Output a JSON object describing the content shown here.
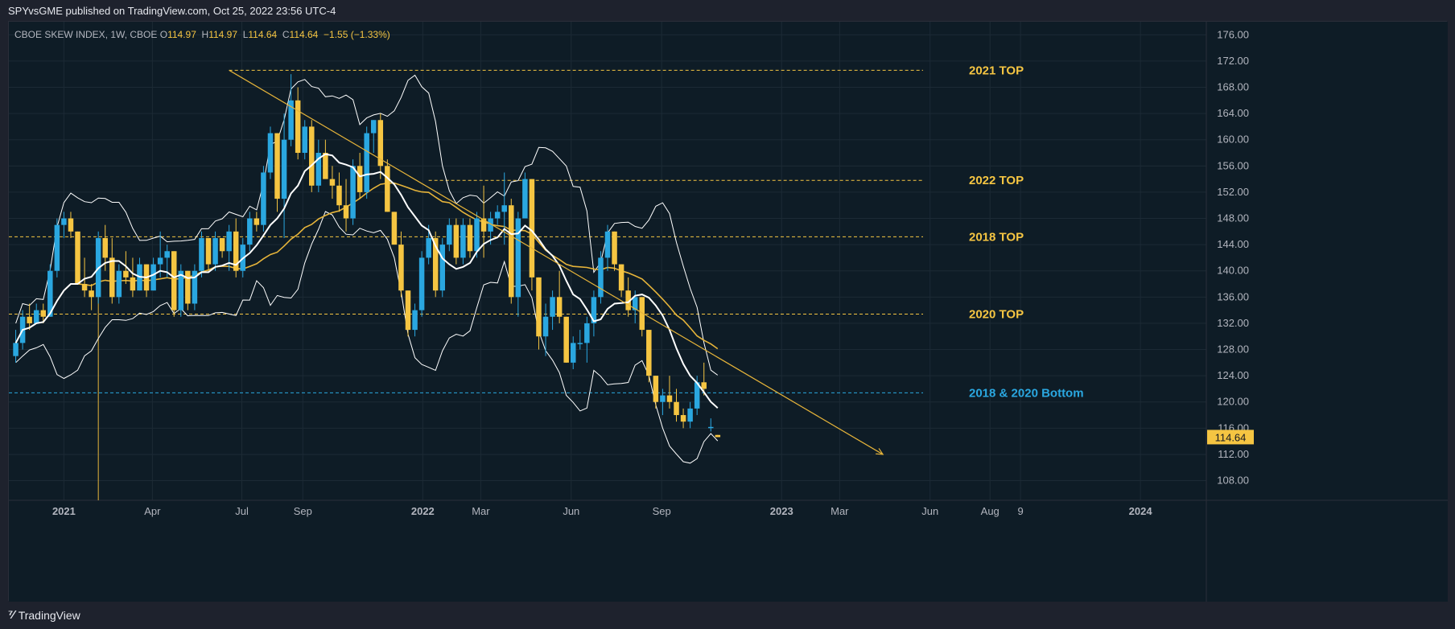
{
  "header": {
    "publish_line": "SPYvsGME published on TradingView.com, Oct 25, 2022 23:56 UTC-4"
  },
  "legend": {
    "symbol": "CBOE SKEW INDEX, 1W, CBOE",
    "o_label": "O",
    "o_value": "114.97",
    "h_label": "H",
    "h_value": "114.97",
    "l_label": "L",
    "l_value": "114.64",
    "c_label": "C",
    "c_value": "114.64",
    "change": "−1.55 (−1.33%)"
  },
  "footer": {
    "brand": "TradingView",
    "logo_icon": "tradingview-logo-icon"
  },
  "colors": {
    "background": "#0e1c26",
    "up": "#2aa7e0",
    "down": "#f5c542",
    "band": "#ffffff",
    "ma": "#e6b43a",
    "level_yellow": "#f5c542",
    "level_blue": "#2aa7e0",
    "axis_text": "#b2b5be",
    "grid": "#1c2a35"
  },
  "chart_data": {
    "type": "candlestick",
    "title": "CBOE SKEW INDEX, 1W, CBOE",
    "x_axis": {
      "tick_labels": [
        "2021",
        "Apr",
        "Jul",
        "Sep",
        "2022",
        "Mar",
        "Jun",
        "Sep",
        "2023",
        "Mar",
        "Jun",
        "Aug",
        "9",
        "2024"
      ],
      "tick_dates": [
        "2021-01-01",
        "2021-04-01",
        "2021-07-01",
        "2021-09-01",
        "2022-01-01",
        "2022-03-01",
        "2022-06-01",
        "2022-09-01",
        "2023-01-01",
        "2023-03-01",
        "2023-06-01",
        "2023-08-01",
        "2023-09-01",
        "2024-01-01"
      ],
      "range": [
        "2020-11-06",
        "2024-03-08"
      ]
    },
    "y_axis": {
      "tick_labels": [
        "108.00",
        "112.00",
        "116.00",
        "120.00",
        "124.00",
        "128.00",
        "132.00",
        "136.00",
        "140.00",
        "144.00",
        "148.00",
        "152.00",
        "156.00",
        "160.00",
        "164.00",
        "168.00",
        "172.00",
        "176.00"
      ],
      "range": [
        105,
        178
      ],
      "last_price_label": "114.64"
    },
    "grid": true,
    "candles": [
      {
        "date": "2020-11-13",
        "o": 127,
        "h": 131,
        "l": 126,
        "c": 129
      },
      {
        "date": "2020-11-20",
        "o": 129,
        "h": 134,
        "l": 128,
        "c": 133
      },
      {
        "date": "2020-11-27",
        "o": 133,
        "h": 135,
        "l": 131,
        "c": 132
      },
      {
        "date": "2020-12-04",
        "o": 132,
        "h": 135,
        "l": 132,
        "c": 134
      },
      {
        "date": "2020-12-11",
        "o": 134,
        "h": 135,
        "l": 132,
        "c": 133
      },
      {
        "date": "2020-12-18",
        "o": 133,
        "h": 141,
        "l": 133,
        "c": 140
      },
      {
        "date": "2020-12-25",
        "o": 140,
        "h": 148,
        "l": 139,
        "c": 147
      },
      {
        "date": "2021-01-01",
        "o": 147,
        "h": 149,
        "l": 145,
        "c": 148
      },
      {
        "date": "2021-01-08",
        "o": 148,
        "h": 149,
        "l": 145,
        "c": 146
      },
      {
        "date": "2021-01-15",
        "o": 146,
        "h": 146,
        "l": 138,
        "c": 138
      },
      {
        "date": "2021-01-22",
        "o": 138,
        "h": 142,
        "l": 136,
        "c": 137
      },
      {
        "date": "2021-01-29",
        "o": 137,
        "h": 138,
        "l": 134,
        "c": 136
      },
      {
        "date": "2021-02-05",
        "o": 136,
        "h": 146,
        "l": 135,
        "c": 145
      },
      {
        "date": "2021-02-12",
        "o": 145,
        "h": 147,
        "l": 140,
        "c": 142
      },
      {
        "date": "2021-02-19",
        "o": 142,
        "h": 145,
        "l": 135,
        "c": 136
      },
      {
        "date": "2021-02-26",
        "o": 136,
        "h": 141,
        "l": 135,
        "c": 140
      },
      {
        "date": "2021-03-05",
        "o": 140,
        "h": 143,
        "l": 138,
        "c": 139
      },
      {
        "date": "2021-03-12",
        "o": 139,
        "h": 142,
        "l": 136,
        "c": 137
      },
      {
        "date": "2021-03-19",
        "o": 137,
        "h": 142,
        "l": 137,
        "c": 141
      },
      {
        "date": "2021-03-26",
        "o": 141,
        "h": 141,
        "l": 136,
        "c": 137
      },
      {
        "date": "2021-04-02",
        "o": 137,
        "h": 142,
        "l": 137,
        "c": 141
      },
      {
        "date": "2021-04-09",
        "o": 141,
        "h": 146,
        "l": 139,
        "c": 142
      },
      {
        "date": "2021-04-16",
        "o": 142,
        "h": 144,
        "l": 139,
        "c": 143
      },
      {
        "date": "2021-04-23",
        "o": 143,
        "h": 143,
        "l": 133,
        "c": 134
      },
      {
        "date": "2021-04-30",
        "o": 134,
        "h": 141,
        "l": 133,
        "c": 140
      },
      {
        "date": "2021-05-07",
        "o": 140,
        "h": 140,
        "l": 134,
        "c": 135
      },
      {
        "date": "2021-05-14",
        "o": 135,
        "h": 141,
        "l": 134,
        "c": 140
      },
      {
        "date": "2021-05-21",
        "o": 140,
        "h": 146,
        "l": 139,
        "c": 145
      },
      {
        "date": "2021-05-28",
        "o": 145,
        "h": 145,
        "l": 140,
        "c": 141
      },
      {
        "date": "2021-06-04",
        "o": 141,
        "h": 146,
        "l": 140,
        "c": 145
      },
      {
        "date": "2021-06-11",
        "o": 145,
        "h": 145,
        "l": 142,
        "c": 143
      },
      {
        "date": "2021-06-18",
        "o": 143,
        "h": 147,
        "l": 140,
        "c": 146
      },
      {
        "date": "2021-06-25",
        "o": 146,
        "h": 148,
        "l": 139,
        "c": 140
      },
      {
        "date": "2021-07-02",
        "o": 140,
        "h": 145,
        "l": 139,
        "c": 144
      },
      {
        "date": "2021-07-09",
        "o": 144,
        "h": 149,
        "l": 143,
        "c": 148
      },
      {
        "date": "2021-07-16",
        "o": 148,
        "h": 149,
        "l": 146,
        "c": 147
      },
      {
        "date": "2021-07-23",
        "o": 147,
        "h": 156,
        "l": 146,
        "c": 155
      },
      {
        "date": "2021-07-30",
        "o": 155,
        "h": 162,
        "l": 154,
        "c": 161
      },
      {
        "date": "2021-08-06",
        "o": 161,
        "h": 161,
        "l": 149,
        "c": 151
      },
      {
        "date": "2021-08-13",
        "o": 151,
        "h": 164,
        "l": 145,
        "c": 160
      },
      {
        "date": "2021-08-20",
        "o": 160,
        "h": 170,
        "l": 159,
        "c": 166
      },
      {
        "date": "2021-08-27",
        "o": 166,
        "h": 168,
        "l": 157,
        "c": 158
      },
      {
        "date": "2021-09-03",
        "o": 158,
        "h": 163,
        "l": 157,
        "c": 162
      },
      {
        "date": "2021-09-10",
        "o": 162,
        "h": 163,
        "l": 152,
        "c": 153
      },
      {
        "date": "2021-09-17",
        "o": 153,
        "h": 160,
        "l": 152,
        "c": 158
      },
      {
        "date": "2021-09-24",
        "o": 158,
        "h": 160,
        "l": 155,
        "c": 154
      },
      {
        "date": "2021-10-01",
        "o": 154,
        "h": 156,
        "l": 151,
        "c": 153
      },
      {
        "date": "2021-10-08",
        "o": 153,
        "h": 155,
        "l": 149,
        "c": 150
      },
      {
        "date": "2021-10-15",
        "o": 150,
        "h": 154,
        "l": 146,
        "c": 148
      },
      {
        "date": "2021-10-22",
        "o": 148,
        "h": 157,
        "l": 147,
        "c": 156
      },
      {
        "date": "2021-10-29",
        "o": 156,
        "h": 158,
        "l": 151,
        "c": 152
      },
      {
        "date": "2021-11-05",
        "o": 152,
        "h": 162,
        "l": 151,
        "c": 161
      },
      {
        "date": "2021-11-12",
        "o": 161,
        "h": 163,
        "l": 158,
        "c": 163
      },
      {
        "date": "2021-11-19",
        "o": 163,
        "h": 164,
        "l": 154,
        "c": 156
      },
      {
        "date": "2021-11-26",
        "o": 156,
        "h": 157,
        "l": 149,
        "c": 149
      },
      {
        "date": "2021-12-03",
        "o": 149,
        "h": 149,
        "l": 144,
        "c": 144
      },
      {
        "date": "2021-12-10",
        "o": 144,
        "h": 146,
        "l": 136,
        "c": 137
      },
      {
        "date": "2021-12-17",
        "o": 137,
        "h": 137,
        "l": 130,
        "c": 131
      },
      {
        "date": "2021-12-24",
        "o": 131,
        "h": 135,
        "l": 130,
        "c": 134
      },
      {
        "date": "2021-12-31",
        "o": 134,
        "h": 143,
        "l": 133,
        "c": 142
      },
      {
        "date": "2022-01-07",
        "o": 142,
        "h": 147,
        "l": 141,
        "c": 145
      },
      {
        "date": "2022-01-14",
        "o": 145,
        "h": 146,
        "l": 136,
        "c": 137
      },
      {
        "date": "2022-01-21",
        "o": 137,
        "h": 145,
        "l": 136,
        "c": 144
      },
      {
        "date": "2022-01-28",
        "o": 144,
        "h": 148,
        "l": 143,
        "c": 147
      },
      {
        "date": "2022-02-04",
        "o": 147,
        "h": 148,
        "l": 141,
        "c": 142
      },
      {
        "date": "2022-02-11",
        "o": 142,
        "h": 148,
        "l": 141,
        "c": 147
      },
      {
        "date": "2022-02-18",
        "o": 147,
        "h": 148,
        "l": 142,
        "c": 143
      },
      {
        "date": "2022-02-25",
        "o": 143,
        "h": 149,
        "l": 142,
        "c": 148
      },
      {
        "date": "2022-03-04",
        "o": 148,
        "h": 153,
        "l": 142,
        "c": 146
      },
      {
        "date": "2022-03-11",
        "o": 146,
        "h": 149,
        "l": 144,
        "c": 148
      },
      {
        "date": "2022-03-18",
        "o": 148,
        "h": 150,
        "l": 147,
        "c": 149
      },
      {
        "date": "2022-03-25",
        "o": 149,
        "h": 155,
        "l": 144,
        "c": 150
      },
      {
        "date": "2022-04-01",
        "o": 150,
        "h": 151,
        "l": 135,
        "c": 136
      },
      {
        "date": "2022-04-08",
        "o": 136,
        "h": 149,
        "l": 133,
        "c": 148
      },
      {
        "date": "2022-04-15",
        "o": 148,
        "h": 155,
        "l": 148,
        "c": 154
      },
      {
        "date": "2022-04-22",
        "o": 154,
        "h": 154,
        "l": 137,
        "c": 139
      },
      {
        "date": "2022-04-29",
        "o": 139,
        "h": 139,
        "l": 128,
        "c": 130
      },
      {
        "date": "2022-05-06",
        "o": 130,
        "h": 135,
        "l": 127,
        "c": 133
      },
      {
        "date": "2022-05-13",
        "o": 133,
        "h": 137,
        "l": 131,
        "c": 136
      },
      {
        "date": "2022-05-20",
        "o": 136,
        "h": 140,
        "l": 132,
        "c": 133
      },
      {
        "date": "2022-05-27",
        "o": 133,
        "h": 133,
        "l": 126,
        "c": 126
      },
      {
        "date": "2022-06-03",
        "o": 126,
        "h": 130,
        "l": 125,
        "c": 129
      },
      {
        "date": "2022-06-10",
        "o": 129,
        "h": 131,
        "l": 128,
        "c": 129
      },
      {
        "date": "2022-06-17",
        "o": 129,
        "h": 133,
        "l": 126,
        "c": 132
      },
      {
        "date": "2022-06-24",
        "o": 132,
        "h": 137,
        "l": 130,
        "c": 136
      },
      {
        "date": "2022-07-01",
        "o": 136,
        "h": 143,
        "l": 135,
        "c": 142
      },
      {
        "date": "2022-07-08",
        "o": 142,
        "h": 147,
        "l": 140,
        "c": 146
      },
      {
        "date": "2022-07-15",
        "o": 146,
        "h": 146,
        "l": 140,
        "c": 141
      },
      {
        "date": "2022-07-22",
        "o": 141,
        "h": 141,
        "l": 136,
        "c": 137
      },
      {
        "date": "2022-07-29",
        "o": 137,
        "h": 139,
        "l": 133,
        "c": 134
      },
      {
        "date": "2022-08-05",
        "o": 134,
        "h": 137,
        "l": 132,
        "c": 136
      },
      {
        "date": "2022-08-12",
        "o": 136,
        "h": 136,
        "l": 130,
        "c": 131
      },
      {
        "date": "2022-08-19",
        "o": 131,
        "h": 131,
        "l": 123,
        "c": 124
      },
      {
        "date": "2022-08-26",
        "o": 124,
        "h": 124,
        "l": 119,
        "c": 120
      },
      {
        "date": "2022-09-02",
        "o": 120,
        "h": 122,
        "l": 118,
        "c": 121
      },
      {
        "date": "2022-09-09",
        "o": 121,
        "h": 124,
        "l": 119,
        "c": 120
      },
      {
        "date": "2022-09-16",
        "o": 120,
        "h": 122,
        "l": 117,
        "c": 118
      },
      {
        "date": "2022-09-23",
        "o": 118,
        "h": 119,
        "l": 116,
        "c": 117
      },
      {
        "date": "2022-09-30",
        "o": 117,
        "h": 120,
        "l": 116,
        "c": 119
      },
      {
        "date": "2022-10-07",
        "o": 119,
        "h": 124,
        "l": 118,
        "c": 123
      },
      {
        "date": "2022-10-14",
        "o": 123,
        "h": 126,
        "l": 121,
        "c": 122
      },
      {
        "date": "2022-10-21",
        "o": 116.19,
        "h": 117.5,
        "l": 115.5,
        "c": 116.19
      },
      {
        "date": "2022-10-28",
        "o": 114.97,
        "h": 114.97,
        "l": 114.64,
        "c": 114.64
      }
    ],
    "levels": [
      {
        "label": "2021 TOP",
        "value": 170.6,
        "color": "#f5c542",
        "from": "2021-06-18"
      },
      {
        "label": "2022 TOP",
        "value": 153.8,
        "color": "#f5c542",
        "from": "2022-01-07"
      },
      {
        "label": "2018 TOP",
        "value": 145.2,
        "color": "#f5c542",
        "from": "2020-11-06"
      },
      {
        "label": "2020 TOP",
        "value": 133.4,
        "color": "#f5c542",
        "from": "2020-11-06"
      },
      {
        "label": "2018 & 2020 Bottom",
        "value": 121.4,
        "color": "#2aa7e0",
        "from": "2020-11-06"
      }
    ],
    "trendline": {
      "start": {
        "date": "2021-06-18",
        "value": 170.6
      },
      "end": {
        "date": "2023-04-14",
        "value": 112.0
      }
    },
    "vertical_marker": {
      "date": "2021-02-05",
      "from_value": 144.5
    }
  }
}
